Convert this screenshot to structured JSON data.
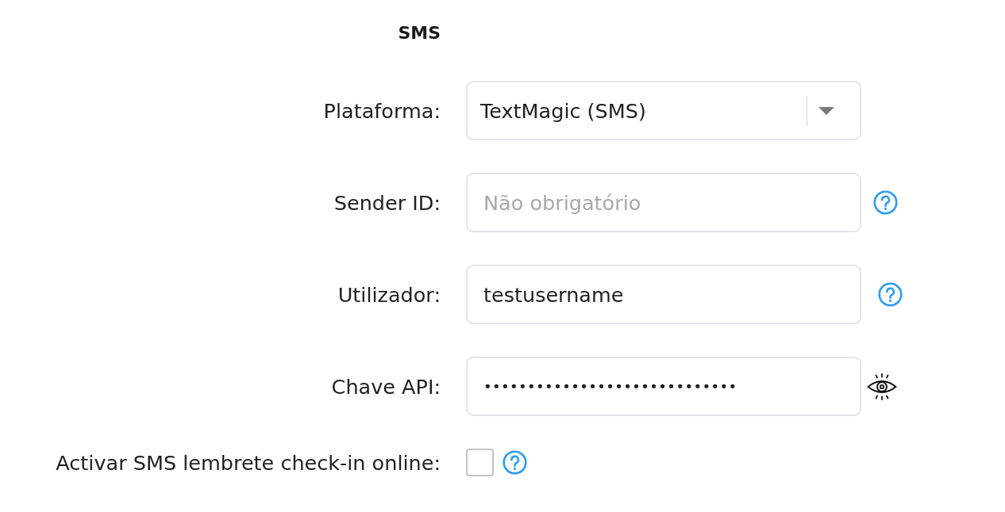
{
  "section": {
    "title": "SMS"
  },
  "fields": [
    {
      "kind": "select",
      "label": "Plataforma:",
      "value": "TextMagic (SMS)",
      "help": false
    },
    {
      "kind": "text",
      "label": "Sender ID:",
      "placeholder": "Não obrigatório",
      "help": true
    },
    {
      "kind": "text",
      "label": "Utilizador:",
      "value": "testusername",
      "help": true
    },
    {
      "kind": "password",
      "label": "Chave API:",
      "value": "•••••••••••••••••••••••••••••",
      "help": false
    },
    {
      "kind": "checkbox",
      "label": "Activar SMS lembrete check-in online:",
      "checked": false,
      "help": true
    }
  ]
}
